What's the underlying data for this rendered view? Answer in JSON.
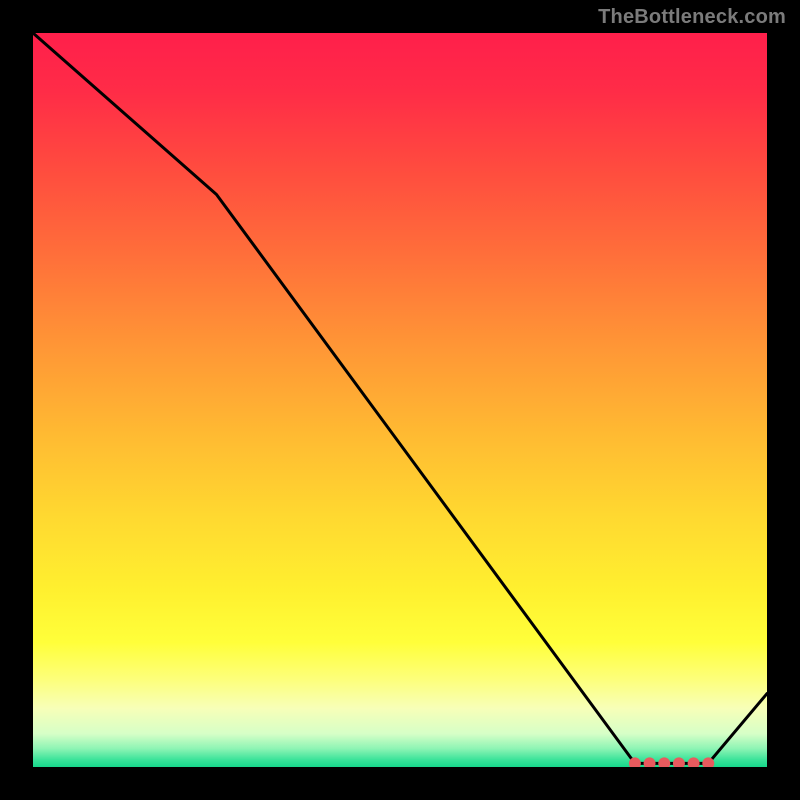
{
  "watermark": "TheBottleneck.com",
  "chart_data": {
    "type": "line",
    "title": "",
    "xlabel": "",
    "ylabel": "",
    "xlim": [
      0,
      100
    ],
    "ylim": [
      0,
      100
    ],
    "grid": false,
    "x": [
      0,
      25,
      82,
      92,
      100
    ],
    "values": [
      100,
      78,
      0.5,
      0.5,
      10
    ],
    "markers": {
      "x": [
        82,
        84,
        86,
        88,
        90,
        92
      ],
      "y": [
        0.5,
        0.5,
        0.5,
        0.5,
        0.5,
        0.5
      ],
      "color": "#e85a5e",
      "size": 6
    },
    "gradient_stops": [
      {
        "offset": 0.0,
        "color": "#ff1f4b"
      },
      {
        "offset": 0.08,
        "color": "#ff2c47"
      },
      {
        "offset": 0.18,
        "color": "#ff4a3f"
      },
      {
        "offset": 0.3,
        "color": "#ff6e3a"
      },
      {
        "offset": 0.42,
        "color": "#ff9436"
      },
      {
        "offset": 0.55,
        "color": "#ffbb32"
      },
      {
        "offset": 0.66,
        "color": "#ffd930"
      },
      {
        "offset": 0.76,
        "color": "#fff02f"
      },
      {
        "offset": 0.83,
        "color": "#ffff3a"
      },
      {
        "offset": 0.88,
        "color": "#fdff7a"
      },
      {
        "offset": 0.92,
        "color": "#f7ffb8"
      },
      {
        "offset": 0.955,
        "color": "#d6ffc7"
      },
      {
        "offset": 0.975,
        "color": "#8df4b4"
      },
      {
        "offset": 0.99,
        "color": "#3be39a"
      },
      {
        "offset": 1.0,
        "color": "#17d88b"
      }
    ]
  }
}
